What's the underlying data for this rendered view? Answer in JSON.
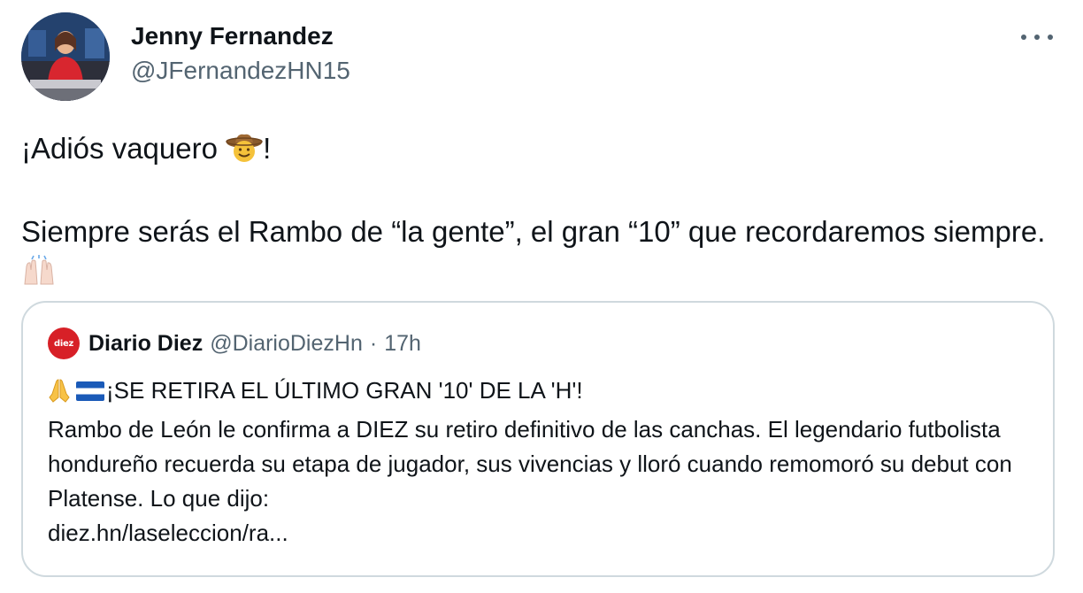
{
  "tweet": {
    "author": {
      "display_name": "Jenny Fernandez",
      "handle": "@JFernandezHN15"
    },
    "text_line1_prefix": "¡Adiós vaquero ",
    "text_line1_emoji": "cowboy-hat-face",
    "text_line1_suffix": "!",
    "text_para2": "Siempre serás el Rambo de “la gente”, el gran “10” que recordaremos siempre.",
    "text_para2_emoji": "raising-hands"
  },
  "quote": {
    "author_name": "Diario Diez",
    "logo_text": "diez",
    "handle": "@DiarioDiezHn",
    "separator": "·",
    "time": "17h",
    "headline": "¡SE RETIRA EL ÚLTIMO GRAN '10' DE LA 'H'!",
    "headline_emojis": [
      "folded-hands",
      "honduras-flag"
    ],
    "body": "Rambo de León le confirma a DIEZ su retiro definitivo de las canchas. El legendario futbolista hondureño recuerda su etapa de jugador, sus vivencias y lloró cuando remomoró su debut con Platense. Lo que dijo:",
    "link": "diez.hn/laseleccion/ra..."
  },
  "colors": {
    "text_primary": "#0f1419",
    "text_secondary": "#536471",
    "border": "#cfd9de",
    "diez_red": "#d72027"
  }
}
